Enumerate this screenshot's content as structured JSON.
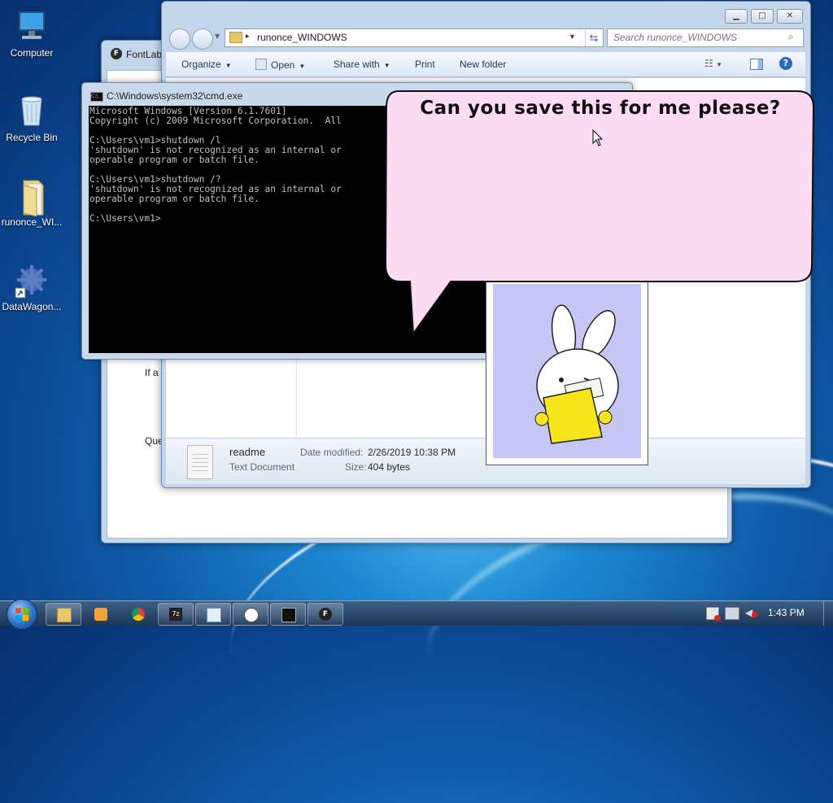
{
  "desktop": {
    "icons": [
      {
        "label": "Computer"
      },
      {
        "label": "Recycle Bin"
      },
      {
        "label": "runonce_WI..."
      },
      {
        "label": "DataWagon..."
      }
    ]
  },
  "fontlab": {
    "title": "FontLab",
    "line1": "If a",
    "line2": "Que"
  },
  "explorer": {
    "address": "runonce_WINDOWS",
    "search_placeholder": "Search runonce_WINDOWS",
    "toolbar": {
      "organize": "Organize",
      "open": "Open",
      "share": "Share with",
      "print": "Print",
      "new_folder": "New folder"
    },
    "details": {
      "name": "readme",
      "type": "Text Document",
      "date_label": "Date modified:",
      "date_value": "2/26/2019 10:38 PM",
      "size_label": "Size:",
      "size_value": "404 bytes"
    }
  },
  "cmd": {
    "title": "C:\\Windows\\system32\\cmd.exe",
    "lines": [
      "Microsoft Windows [Version 6.1.7601]",
      "Copyright (c) 2009 Microsoft Corporation.  All",
      "",
      "C:\\Users\\vm1>shutdown /l",
      "'shutdown' is not recognized as an internal or",
      "operable program or batch file.",
      "",
      "C:\\Users\\vm1>shutdown /?",
      "'shutdown' is not recognized as an internal or",
      "operable program or batch file.",
      "",
      "C:\\Users\\vm1>"
    ]
  },
  "popup": {
    "message": "Can you save this for me please?"
  },
  "taskbar": {
    "time": "1:43 PM",
    "icons": [
      "explorer-icon",
      "media-player-icon",
      "chrome-icon",
      "7zip-icon",
      "notepad-icon",
      "mascot-icon",
      "cmd-icon",
      "fontlab-icon"
    ]
  },
  "colors": {
    "popup_bg": "#fbdcf3",
    "mascot_bg": "#c6c6f5",
    "folder": "#f5e51a"
  }
}
